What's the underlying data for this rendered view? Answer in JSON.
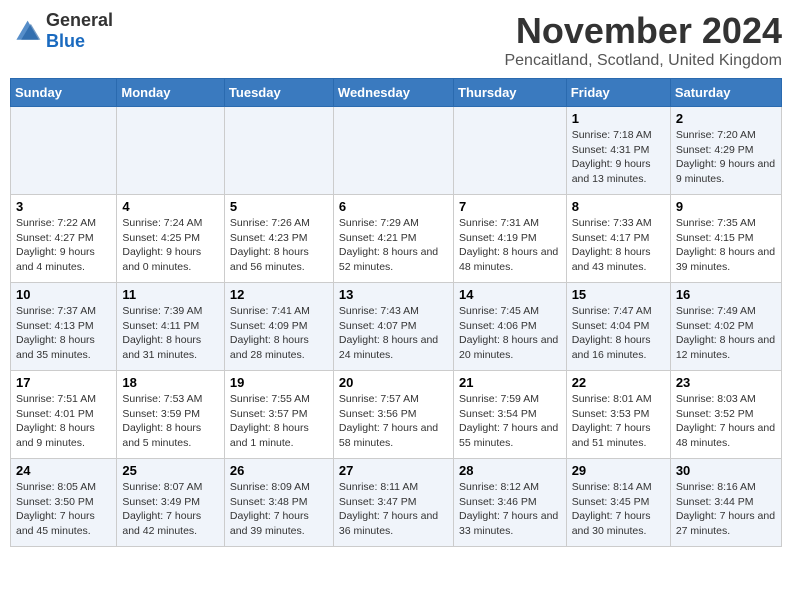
{
  "logo": {
    "general": "General",
    "blue": "Blue"
  },
  "title": "November 2024",
  "location": "Pencaitland, Scotland, United Kingdom",
  "days_header": [
    "Sunday",
    "Monday",
    "Tuesday",
    "Wednesday",
    "Thursday",
    "Friday",
    "Saturday"
  ],
  "weeks": [
    [
      {
        "day": "",
        "content": ""
      },
      {
        "day": "",
        "content": ""
      },
      {
        "day": "",
        "content": ""
      },
      {
        "day": "",
        "content": ""
      },
      {
        "day": "",
        "content": ""
      },
      {
        "day": "1",
        "content": "Sunrise: 7:18 AM\nSunset: 4:31 PM\nDaylight: 9 hours and 13 minutes."
      },
      {
        "day": "2",
        "content": "Sunrise: 7:20 AM\nSunset: 4:29 PM\nDaylight: 9 hours and 9 minutes."
      }
    ],
    [
      {
        "day": "3",
        "content": "Sunrise: 7:22 AM\nSunset: 4:27 PM\nDaylight: 9 hours and 4 minutes."
      },
      {
        "day": "4",
        "content": "Sunrise: 7:24 AM\nSunset: 4:25 PM\nDaylight: 9 hours and 0 minutes."
      },
      {
        "day": "5",
        "content": "Sunrise: 7:26 AM\nSunset: 4:23 PM\nDaylight: 8 hours and 56 minutes."
      },
      {
        "day": "6",
        "content": "Sunrise: 7:29 AM\nSunset: 4:21 PM\nDaylight: 8 hours and 52 minutes."
      },
      {
        "day": "7",
        "content": "Sunrise: 7:31 AM\nSunset: 4:19 PM\nDaylight: 8 hours and 48 minutes."
      },
      {
        "day": "8",
        "content": "Sunrise: 7:33 AM\nSunset: 4:17 PM\nDaylight: 8 hours and 43 minutes."
      },
      {
        "day": "9",
        "content": "Sunrise: 7:35 AM\nSunset: 4:15 PM\nDaylight: 8 hours and 39 minutes."
      }
    ],
    [
      {
        "day": "10",
        "content": "Sunrise: 7:37 AM\nSunset: 4:13 PM\nDaylight: 8 hours and 35 minutes."
      },
      {
        "day": "11",
        "content": "Sunrise: 7:39 AM\nSunset: 4:11 PM\nDaylight: 8 hours and 31 minutes."
      },
      {
        "day": "12",
        "content": "Sunrise: 7:41 AM\nSunset: 4:09 PM\nDaylight: 8 hours and 28 minutes."
      },
      {
        "day": "13",
        "content": "Sunrise: 7:43 AM\nSunset: 4:07 PM\nDaylight: 8 hours and 24 minutes."
      },
      {
        "day": "14",
        "content": "Sunrise: 7:45 AM\nSunset: 4:06 PM\nDaylight: 8 hours and 20 minutes."
      },
      {
        "day": "15",
        "content": "Sunrise: 7:47 AM\nSunset: 4:04 PM\nDaylight: 8 hours and 16 minutes."
      },
      {
        "day": "16",
        "content": "Sunrise: 7:49 AM\nSunset: 4:02 PM\nDaylight: 8 hours and 12 minutes."
      }
    ],
    [
      {
        "day": "17",
        "content": "Sunrise: 7:51 AM\nSunset: 4:01 PM\nDaylight: 8 hours and 9 minutes."
      },
      {
        "day": "18",
        "content": "Sunrise: 7:53 AM\nSunset: 3:59 PM\nDaylight: 8 hours and 5 minutes."
      },
      {
        "day": "19",
        "content": "Sunrise: 7:55 AM\nSunset: 3:57 PM\nDaylight: 8 hours and 1 minute."
      },
      {
        "day": "20",
        "content": "Sunrise: 7:57 AM\nSunset: 3:56 PM\nDaylight: 7 hours and 58 minutes."
      },
      {
        "day": "21",
        "content": "Sunrise: 7:59 AM\nSunset: 3:54 PM\nDaylight: 7 hours and 55 minutes."
      },
      {
        "day": "22",
        "content": "Sunrise: 8:01 AM\nSunset: 3:53 PM\nDaylight: 7 hours and 51 minutes."
      },
      {
        "day": "23",
        "content": "Sunrise: 8:03 AM\nSunset: 3:52 PM\nDaylight: 7 hours and 48 minutes."
      }
    ],
    [
      {
        "day": "24",
        "content": "Sunrise: 8:05 AM\nSunset: 3:50 PM\nDaylight: 7 hours and 45 minutes."
      },
      {
        "day": "25",
        "content": "Sunrise: 8:07 AM\nSunset: 3:49 PM\nDaylight: 7 hours and 42 minutes."
      },
      {
        "day": "26",
        "content": "Sunrise: 8:09 AM\nSunset: 3:48 PM\nDaylight: 7 hours and 39 minutes."
      },
      {
        "day": "27",
        "content": "Sunrise: 8:11 AM\nSunset: 3:47 PM\nDaylight: 7 hours and 36 minutes."
      },
      {
        "day": "28",
        "content": "Sunrise: 8:12 AM\nSunset: 3:46 PM\nDaylight: 7 hours and 33 minutes."
      },
      {
        "day": "29",
        "content": "Sunrise: 8:14 AM\nSunset: 3:45 PM\nDaylight: 7 hours and 30 minutes."
      },
      {
        "day": "30",
        "content": "Sunrise: 8:16 AM\nSunset: 3:44 PM\nDaylight: 7 hours and 27 minutes."
      }
    ]
  ]
}
